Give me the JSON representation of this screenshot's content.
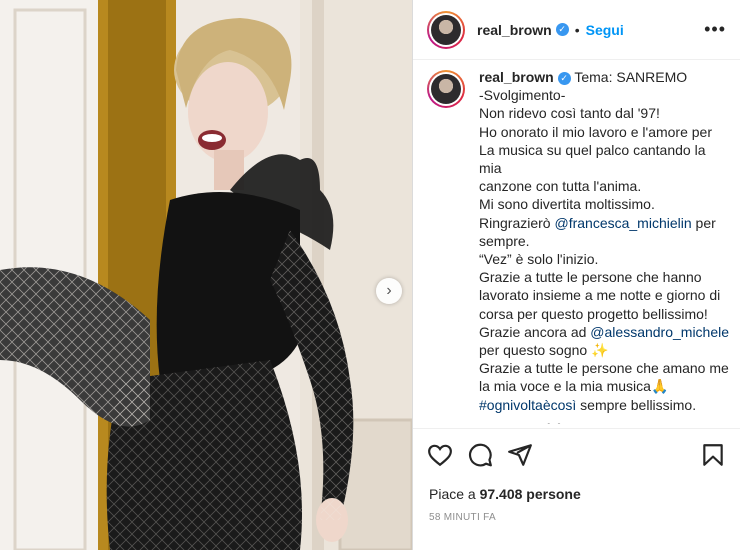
{
  "post": {
    "username": "real_brown",
    "verified_mark": "✓",
    "separator": "•",
    "follow_label": "Segui",
    "more_icon": "more-horizontal-icon",
    "caption_line_first": "Tema: SANREMO",
    "caption_lines": [
      "-Svolgimento-",
      "Non ridevo così tanto dal '97!",
      "Ho onorato il mio lavoro e l'amore per",
      "La musica su quel palco cantando la mia",
      "canzone con tutta l'anima.",
      "Mi sono divertita moltissimo."
    ],
    "thanks_prefix": "Ringrazierò ",
    "thanks_mention": "@francesca_michielin",
    "thanks_suffix": " per",
    "line_sempre": "sempre.",
    "line_vez": "“Vez” è solo l'inizio.",
    "caption_lines_2": [
      "Grazie a tutte le persone che hanno",
      "lavorato insieme a me notte e giorno di",
      "corsa per questo progetto bellissimo!"
    ],
    "thanks2_prefix": "Grazie ancora ad ",
    "thanks2_mention": "@alessandro_michele",
    "line_sogno": "per questo sogno ✨",
    "line_amano": "Grazie a tutte le persone che amano me",
    "line_voce": "la mia voce e la mia musica🙏",
    "hashtag": "#ognivoltaècosì",
    "hashtag_suffix": " sempre bellissimo.",
    "likes_prefix": "Piace a ",
    "likes_count": "97.408",
    "likes_suffix": " persone",
    "time_ago": "58 MINUTI FA",
    "next_arrow": "›"
  },
  "colors": {
    "link": "#00376b",
    "follow": "#0095f6",
    "verified": "#3897f0"
  }
}
